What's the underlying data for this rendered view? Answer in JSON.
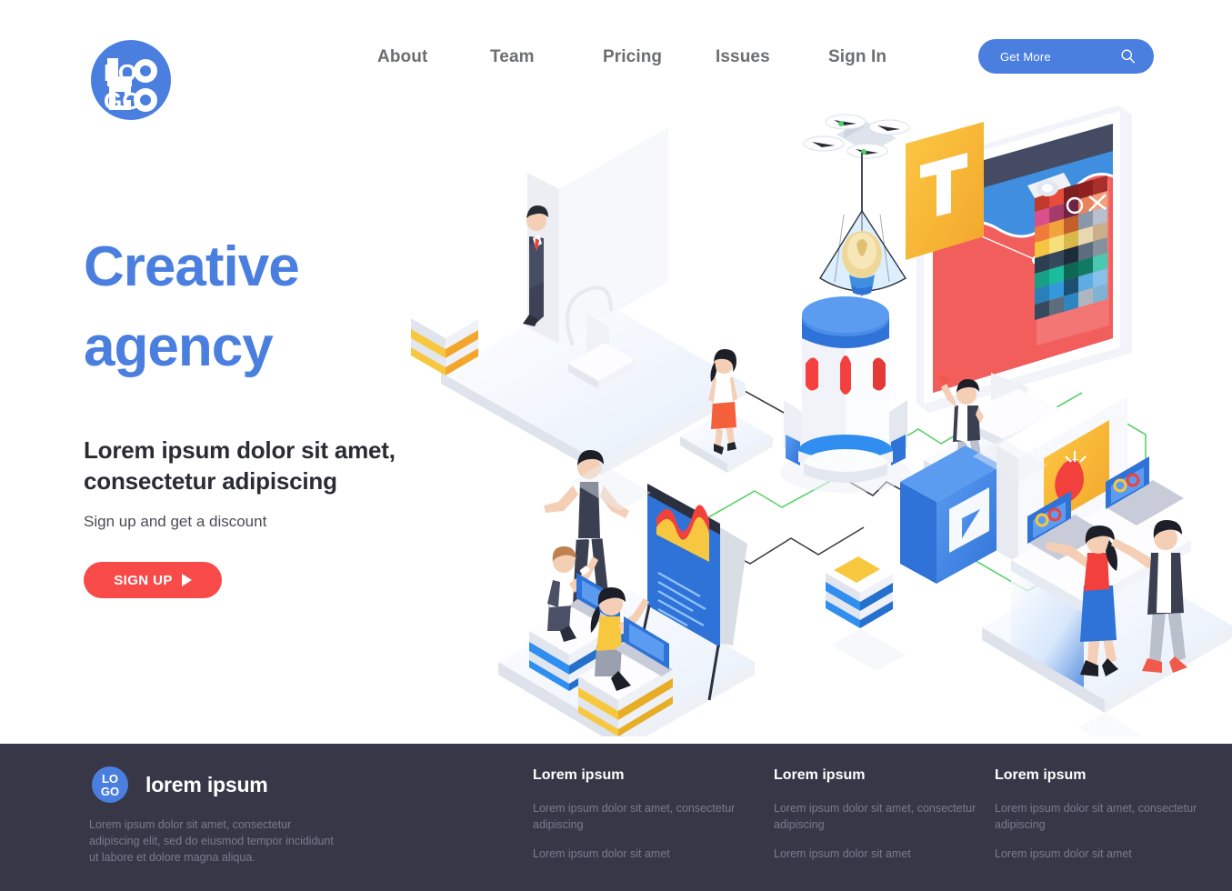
{
  "header": {
    "logo_text": "LOGO",
    "nav": [
      {
        "label": "About"
      },
      {
        "label": "Team"
      },
      {
        "label": "Pricing"
      },
      {
        "label": "Issues"
      },
      {
        "label": "Sign In"
      }
    ],
    "cta": {
      "label": "Get More",
      "icon": "search-icon",
      "color": "#4a7fe0"
    }
  },
  "hero": {
    "title_line1": "Creative",
    "title_line2": "agency",
    "title_color": "#4a7fe0",
    "subtitle_line1": "Lorem ipsum dolor sit amet,",
    "subtitle_line2": "consectetur adipiscing",
    "note": "Sign up and get a discount",
    "button": {
      "label": "SIGN UP",
      "icon": "play-icon",
      "color": "#f94a4a"
    }
  },
  "illustration": {
    "name": "isometric-creative-agency-scene",
    "screen_window_label": "T",
    "window_controls": "O X",
    "palette_colors": [
      "#c0392b",
      "#e74c3c",
      "#8e2020",
      "#7b1f1f",
      "#d94f8a",
      "#a63a6a",
      "#e8835a",
      "#f0a07a",
      "#f2a33c",
      "#f5c542",
      "#f7e07a",
      "#b7c0cc",
      "#2c3e50",
      "#34495e",
      "#16a085",
      "#1abc9c",
      "#2980b9",
      "#3498db",
      "#5dade2",
      "#85c1e9"
    ],
    "accent_blue": "#4a7fe0",
    "accent_red": "#f94a4a",
    "accent_yellow": "#f7b731",
    "accent_green": "#5bd16a"
  },
  "footer": {
    "brand": {
      "logo_text": "LOGO",
      "name": "lorem ipsum"
    },
    "description": "Lorem ipsum dolor sit amet, consectetur adipiscing elit, sed do eiusmod tempor incididunt ut labore et dolore magna aliqua.",
    "background": "#373748",
    "columns": [
      {
        "title": "Lorem ipsum",
        "links": [
          "Lorem ipsum dolor sit amet, consectetur adipiscing",
          "Lorem ipsum dolor sit amet"
        ]
      },
      {
        "title": "Lorem ipsum",
        "links": [
          "Lorem ipsum dolor sit amet, consectetur adipiscing",
          "Lorem ipsum dolor sit amet"
        ]
      },
      {
        "title": "Lorem ipsum",
        "links": [
          "Lorem ipsum dolor sit amet, consectetur adipiscing",
          "Lorem ipsum dolor sit amet"
        ]
      }
    ]
  }
}
